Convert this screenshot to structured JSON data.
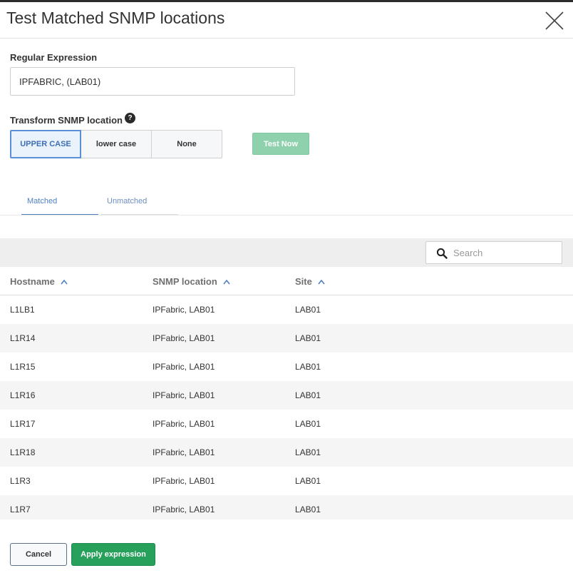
{
  "dialog": {
    "title": "Test Matched SNMP locations"
  },
  "regex": {
    "label": "Regular Expression",
    "value": "IPFABRIC, (LAB01)"
  },
  "transform": {
    "label": "Transform SNMP location",
    "help_glyph": "?",
    "options": [
      "UPPER CASE",
      "lower case",
      "None"
    ],
    "selected": "UPPER CASE"
  },
  "test_button": "Test Now",
  "tabs": [
    "Matched",
    "Unmatched"
  ],
  "active_tab": "Matched",
  "search": {
    "placeholder": "Search"
  },
  "table": {
    "columns": [
      "Hostname",
      "SNMP location",
      "Site"
    ],
    "rows": [
      [
        "L1LB1",
        "IPFabric, LAB01",
        "LAB01"
      ],
      [
        "L1R14",
        "IPFabric, LAB01",
        "LAB01"
      ],
      [
        "L1R15",
        "IPFabric, LAB01",
        "LAB01"
      ],
      [
        "L1R16",
        "IPFabric, LAB01",
        "LAB01"
      ],
      [
        "L1R17",
        "IPFabric, LAB01",
        "LAB01"
      ],
      [
        "L1R18",
        "IPFabric, LAB01",
        "LAB01"
      ],
      [
        "L1R3",
        "IPFabric, LAB01",
        "LAB01"
      ],
      [
        "L1R7",
        "IPFabric, LAB01",
        "LAB01"
      ]
    ]
  },
  "footer": {
    "cancel": "Cancel",
    "apply": "Apply expression"
  },
  "colors": {
    "accent": "#4f7fc0",
    "primary_green": "#27a05c",
    "disabled_green": "#8fd1ad"
  }
}
